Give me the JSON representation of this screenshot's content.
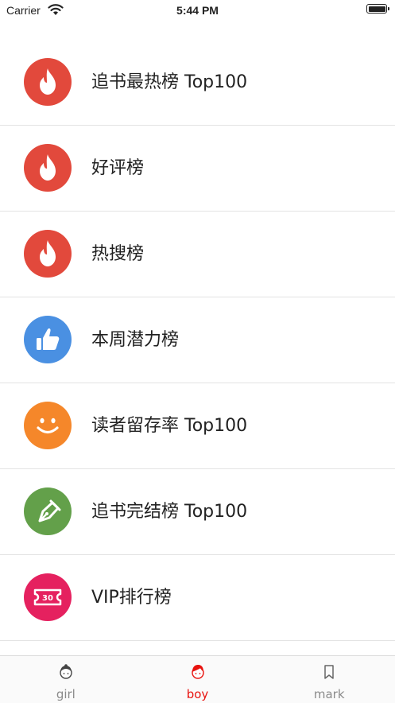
{
  "status_bar": {
    "carrier": "Carrier",
    "time": "5:44 PM"
  },
  "rank_list": [
    {
      "label": "追书最热榜 Top100",
      "icon": "fire-icon",
      "color": "#e2493c"
    },
    {
      "label": "好评榜",
      "icon": "fire-icon",
      "color": "#e2493c"
    },
    {
      "label": "热搜榜",
      "icon": "fire-icon",
      "color": "#e2493c"
    },
    {
      "label": "本周潜力榜",
      "icon": "thumbs-up-icon",
      "color": "#4a90e2"
    },
    {
      "label": "读者留存率 Top100",
      "icon": "smile-icon",
      "color": "#f5872a"
    },
    {
      "label": "追书完结榜 Top100",
      "icon": "pen-nib-icon",
      "color": "#63a04a"
    },
    {
      "label": "VIP排行榜",
      "icon": "ticket-icon",
      "color": "#e5215f",
      "badge": "30"
    }
  ],
  "tab_bar": {
    "tabs": [
      {
        "label": "girl",
        "icon": "girl-avatar-icon",
        "active": false
      },
      {
        "label": "boy",
        "icon": "boy-avatar-icon",
        "active": true
      },
      {
        "label": "mark",
        "icon": "bookmark-icon",
        "active": false
      }
    ],
    "active_color": "#e8130f",
    "inactive_color": "#8a8a8a"
  }
}
